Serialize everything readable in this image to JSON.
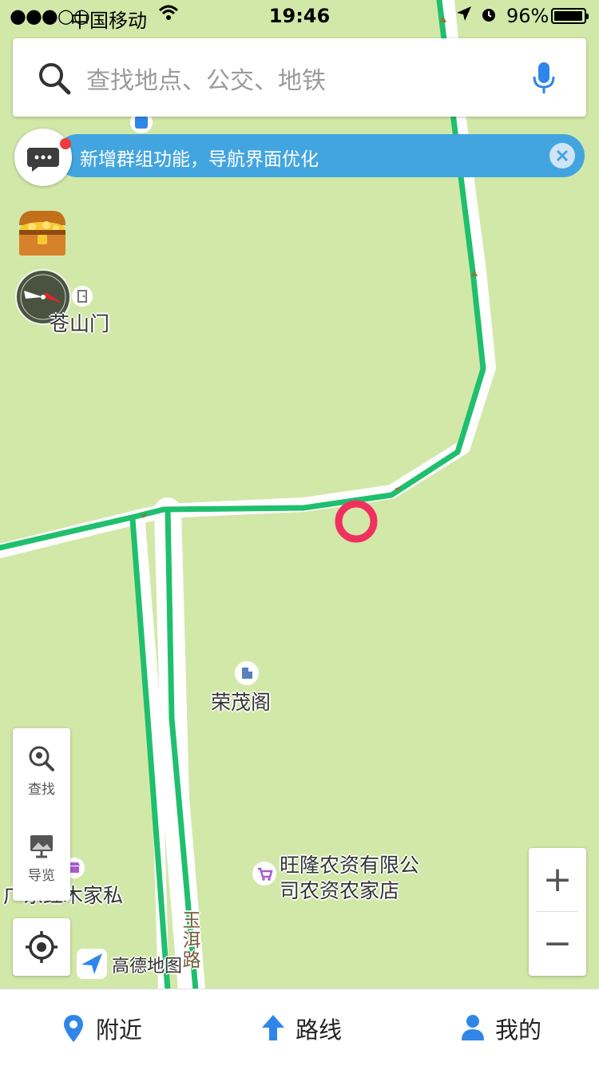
{
  "status_bar": {
    "signal": "●●●○○",
    "carrier": "中国移动",
    "time": "19:46",
    "battery_percent": "96%",
    "battery_level": 0.96
  },
  "search": {
    "placeholder": "查找地点、公交、地铁"
  },
  "notice": {
    "text": "新增群组功能，导航界面优化"
  },
  "map_labels": {
    "cangshanmen": "苍山门",
    "rongmaoge": "荣茂阁",
    "wanglong_line1": "旺隆农资有限公",
    "wanglong_line2": "司农资农家店",
    "furniture": "广东红木家私",
    "road": "玉洱路"
  },
  "tools": {
    "find": "查找",
    "overview": "导览"
  },
  "zoom": {
    "in": "+",
    "out": "−"
  },
  "brand": {
    "logo_text": "高德地图"
  },
  "tabbar": {
    "nearby": "附近",
    "route": "路线",
    "mine": "我的"
  },
  "colors": {
    "map_bg": "#d2e8a9",
    "road_green": "#1fbf6e",
    "notice_blue": "#43a5e0",
    "accent_blue": "#2f86e8",
    "marker_red": "#f0315f"
  },
  "icons": [
    "search-icon",
    "mic-icon",
    "message-icon",
    "close-icon",
    "treasure-chest-icon",
    "compass-icon",
    "exit-door-icon",
    "building-icon",
    "shopping-cart-icon",
    "shop-icon",
    "find-nearby-icon",
    "overview-icon",
    "locate-icon",
    "amap-logo-icon",
    "location-pin-icon",
    "route-arrow-icon",
    "user-icon"
  ]
}
